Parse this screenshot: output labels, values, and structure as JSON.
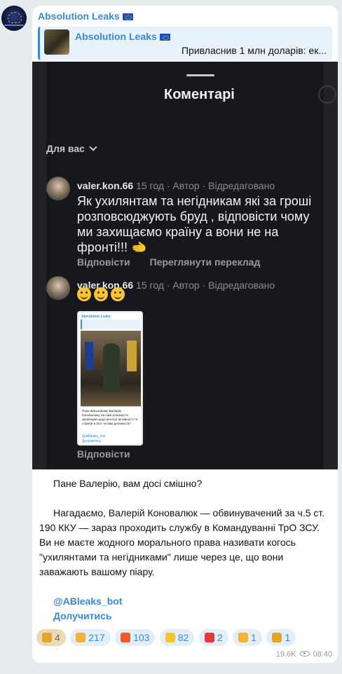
{
  "message": {
    "channel_name": "Absolution Leaks",
    "reply": {
      "title": "Absolution Leaks",
      "preview": "Привласнив 1 млн доларів: ек..."
    },
    "screenshot": {
      "title": "Коментарі",
      "filter": "Для вас",
      "comments": [
        {
          "user": "valer.kon.66",
          "meta": "15 год · Автор · Відредаговано",
          "text": "Як ухилянтам та негідникам  які за гроші розповсюджують бруд , відповісти чому ми захищаємо країну а вони не на фронті!!! 🫲",
          "reply_label": "Відповісти",
          "translate_label": "Переглянути переклад"
        },
        {
          "user": "valer.kon.66",
          "meta": "15 год · Автор · Відредаговано",
          "emojis": [
            "grinning-face",
            "grinning-face",
            "grinning-face"
          ],
          "reply_label": "Відповісти",
          "embedded": {
            "channel": "Absolution Leaks",
            "text": "Пане військовому Валерію Коновалюку, ви самі розказуєте українцям щодо рентної активності та служби в ЗСУ чи вам допомогти?",
            "link1": "@ABleaks_bot",
            "link2": "Долучитись"
          }
        }
      ]
    },
    "body": {
      "p1": "Пане Валерію, вам досі смішно?",
      "p2": "Нагадаємо, Валерій Коновалюк — обвинувачений за ч.5 ст. 190 ККУ — зараз проходить службу в Командуванні ТрО ЗСУ. Ви не маєте жодного морального права називати когось \"ухилянтами та негідниками\" лише через це, що вони заважають вашому піару.",
      "bot_link": "@ABleaks_bot",
      "join_link": "Долучитись"
    },
    "reactions": [
      {
        "icon": "star-icon",
        "count": "4",
        "color": "#e2a726"
      },
      {
        "icon": "thumbs-up-icon",
        "count": "217",
        "color": "#f1b23a"
      },
      {
        "icon": "fire-icon",
        "count": "103",
        "color": "#ef5a2a"
      },
      {
        "icon": "lightning-icon",
        "count": "82",
        "color": "#f3c531"
      },
      {
        "icon": "hundred-icon",
        "count": "2",
        "color": "#e53935"
      },
      {
        "icon": "ok-hand-icon",
        "count": "1",
        "color": "#f1b23a"
      },
      {
        "icon": "trophy-icon",
        "count": "1",
        "color": "#e2a726"
      }
    ],
    "views": "19.6K",
    "time": "08:40"
  }
}
